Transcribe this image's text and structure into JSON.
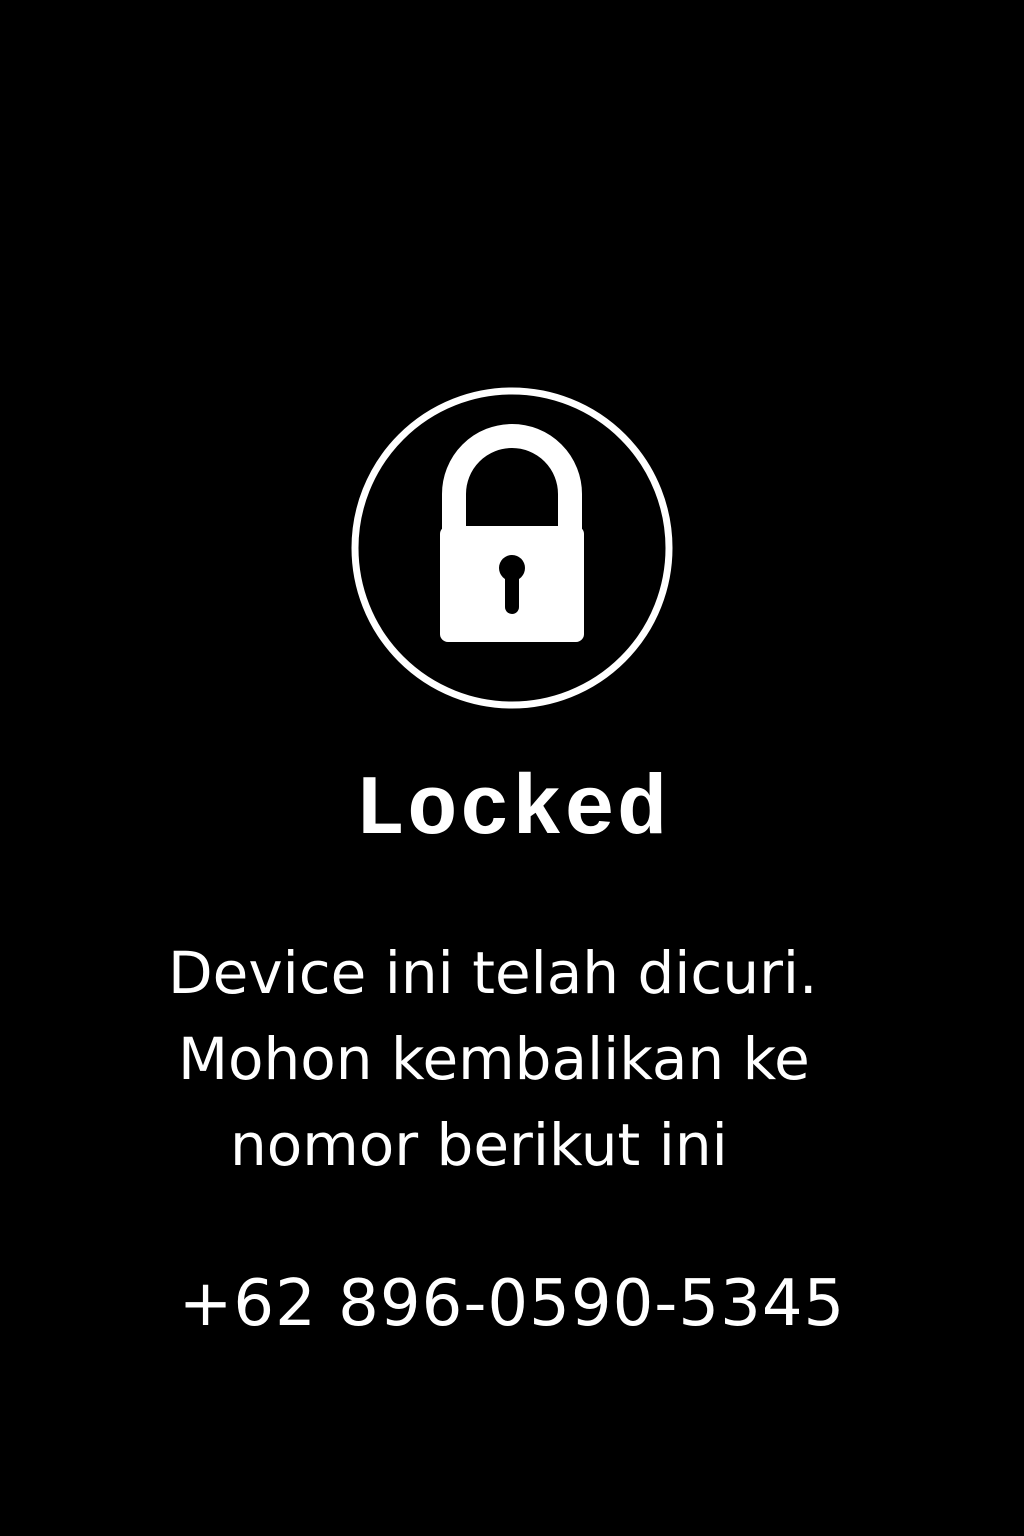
{
  "lock_screen": {
    "icon": "padlock-icon",
    "title": "Locked",
    "message_lines": [
      "Device ini telah dicuri.",
      "Mohon kembalikan ke",
      "nomor berikut ini"
    ],
    "phone_number": "+62 896-0590-5345"
  },
  "colors": {
    "background": "#000000",
    "foreground": "#ffffff"
  }
}
